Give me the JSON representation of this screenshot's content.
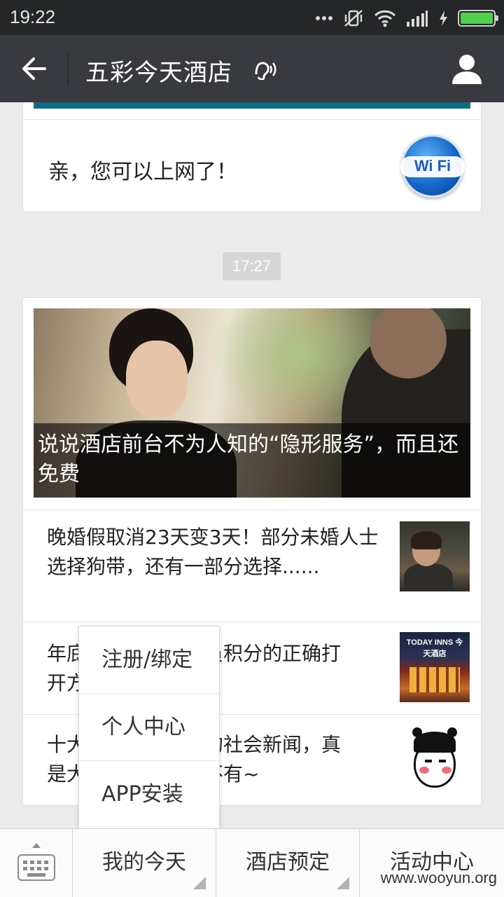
{
  "status_bar": {
    "time": "19:22",
    "icons": [
      "more-dots-icon",
      "mute-vibrate-icon",
      "wifi-icon",
      "signal-icon",
      "charging-icon",
      "battery-icon"
    ]
  },
  "header": {
    "title": "五彩今天酒店",
    "back_icon": "arrow-left-icon",
    "ear_icon": "ear-icon",
    "profile_icon": "person-icon"
  },
  "wifi_message": {
    "text": "亲，您可以上网了！",
    "badge": "Wi Fi"
  },
  "timestamp": "17:27",
  "news": {
    "hero_caption": "说说酒店前台不为人知的“隐形服务”，而且还免费",
    "items": [
      {
        "text": "晚婚假取消23天变3天！部分未婚人士选择狗带，还有一部分选择......"
      },
      {
        "text": "年底酒店会员积分的正确打开方式",
        "visible_prefix": "年底",
        "visible_suffix": "员积分的正确打",
        "line2_prefix": "开方"
      },
      {
        "text": "十大奇葩的社会新闻，真是无奇不有~",
        "line1_prefix": "十大",
        "line1_suffix": "的社会新闻，真",
        "line2_prefix": "是大",
        "line2_suffix": "不有~"
      }
    ],
    "thumb2_sign": "TODAY INNS 今天酒店"
  },
  "popup_menu": {
    "items": [
      "注册/绑定",
      "个人中心",
      "APP安装"
    ]
  },
  "bottom_menu": {
    "keyboard_icon": "keyboard-icon",
    "items": [
      "我的今天",
      "酒店预定",
      "活动中心"
    ]
  },
  "watermark": "www.wooyun.org",
  "colors": {
    "header_bg": "#393a3f",
    "status_bg": "#242628",
    "page_bg": "#ebebeb",
    "battery": "#4fd14f"
  }
}
